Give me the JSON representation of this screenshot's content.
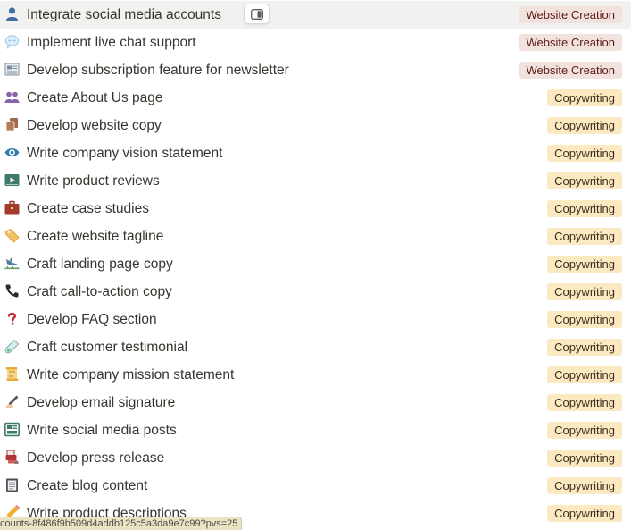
{
  "rows": [
    {
      "title": "Integrate social media accounts",
      "tag": "Website Creation",
      "icon": "person-icon"
    },
    {
      "title": "Implement live chat support",
      "tag": "Website Creation",
      "icon": "speech-balloon-icon"
    },
    {
      "title": "Develop subscription feature for newsletter",
      "tag": "Website Creation",
      "icon": "newspaper-icon"
    },
    {
      "title": "Create About Us page",
      "tag": "Copywriting",
      "icon": "people-icon"
    },
    {
      "title": "Develop website copy",
      "tag": "Copywriting",
      "icon": "copy-pages-icon"
    },
    {
      "title": "Write company vision statement",
      "tag": "Copywriting",
      "icon": "eye-icon"
    },
    {
      "title": "Write product reviews",
      "tag": "Copywriting",
      "icon": "video-icon"
    },
    {
      "title": "Create case studies",
      "tag": "Copywriting",
      "icon": "briefcase-icon"
    },
    {
      "title": "Create website tagline",
      "tag": "Copywriting",
      "icon": "label-tag-icon"
    },
    {
      "title": "Craft landing page copy",
      "tag": "Copywriting",
      "icon": "airplane-landing-icon"
    },
    {
      "title": "Craft call-to-action copy",
      "tag": "Copywriting",
      "icon": "telephone-icon"
    },
    {
      "title": "Develop FAQ section",
      "tag": "Copywriting",
      "icon": "question-mark-icon"
    },
    {
      "title": "Craft customer testimonial",
      "tag": "Copywriting",
      "icon": "test-tube-icon"
    },
    {
      "title": "Write company mission statement",
      "tag": "Copywriting",
      "icon": "scroll-icon"
    },
    {
      "title": "Develop email signature",
      "tag": "Copywriting",
      "icon": "writing-hand-icon"
    },
    {
      "title": "Write social media posts",
      "tag": "Copywriting",
      "icon": "dashboard-icon"
    },
    {
      "title": "Develop press release",
      "tag": "Copywriting",
      "icon": "printing-press-icon"
    },
    {
      "title": "Create blog content",
      "tag": "Copywriting",
      "icon": "notepad-icon"
    },
    {
      "title": "Write product descriptions",
      "tag": "Copywriting",
      "icon": "pencil-icon"
    }
  ],
  "status_url": "counts-8f486f9b509d4addb125c5a3da9e7c99?pvs=25",
  "colors": {
    "tag_website_bg": "#f1e2de",
    "tag_copywriting_bg": "#fbeac1",
    "hover_row_bg": "#f1f1ef"
  }
}
